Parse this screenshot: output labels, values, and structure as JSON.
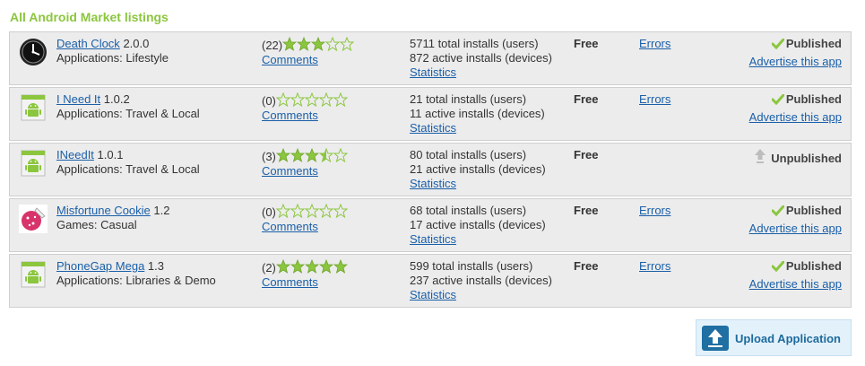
{
  "heading": "All Android Market listings",
  "colors": {
    "accent": "#8bc63e",
    "link": "#1a5fa8",
    "star": "#8bc63e",
    "check": "#8bc63e"
  },
  "apps": [
    {
      "icon": "clock-icon",
      "name": "Death Clock",
      "version": "2.0.0",
      "category": "Applications: Lifestyle",
      "rating_count": "(22)",
      "stars": 3,
      "comments": "Comments",
      "total_installs": "5711 total installs (users)",
      "active_installs": "872 active installs (devices)",
      "statistics": "Statistics",
      "price": "Free",
      "errors": "Errors",
      "status": "Published",
      "advertise": "Advertise this app"
    },
    {
      "icon": "android-icon",
      "name": "I Need It",
      "version": "1.0.2",
      "category": "Applications: Travel & Local",
      "rating_count": "(0)",
      "stars": 0,
      "comments": "Comments",
      "total_installs": "21 total installs (users)",
      "active_installs": "11 active installs (devices)",
      "statistics": "Statistics",
      "price": "Free",
      "errors": "Errors",
      "status": "Published",
      "advertise": "Advertise this app"
    },
    {
      "icon": "android-icon",
      "name": "INeedIt",
      "version": "1.0.1",
      "category": "Applications: Travel & Local",
      "rating_count": "(3)",
      "stars": 3.5,
      "comments": "Comments",
      "total_installs": "80 total installs (users)",
      "active_installs": "21 active installs (devices)",
      "statistics": "Statistics",
      "price": "Free",
      "errors": "",
      "status": "Unpublished",
      "advertise": ""
    },
    {
      "icon": "cookie-icon",
      "name": "Misfortune Cookie",
      "version": "1.2",
      "category": "Games: Casual",
      "rating_count": "(0)",
      "stars": 0,
      "comments": "Comments",
      "total_installs": "68 total installs (users)",
      "active_installs": "17 active installs (devices)",
      "statistics": "Statistics",
      "price": "Free",
      "errors": "Errors",
      "status": "Published",
      "advertise": "Advertise this app"
    },
    {
      "icon": "android-icon",
      "name": "PhoneGap Mega",
      "version": "1.3",
      "category": "Applications: Libraries & Demo",
      "rating_count": "(2)",
      "stars": 5,
      "comments": "Comments",
      "total_installs": "599 total installs (users)",
      "active_installs": "237 active installs (devices)",
      "statistics": "Statistics",
      "price": "Free",
      "errors": "Errors",
      "status": "Published",
      "advertise": "Advertise this app"
    }
  ],
  "upload_button": {
    "label": "Upload Application",
    "icon": "upload-arrow-icon"
  }
}
